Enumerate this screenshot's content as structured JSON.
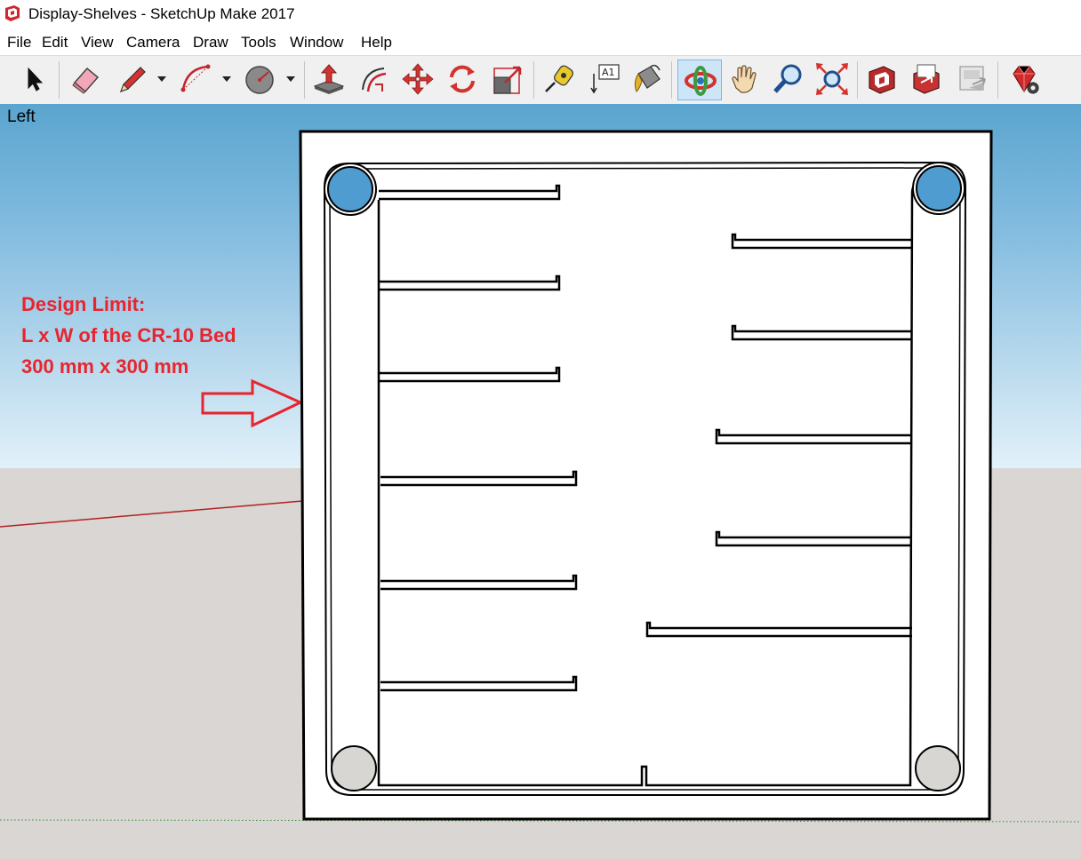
{
  "window": {
    "title": "Display-Shelves - SketchUp Make 2017",
    "app_icon": "sketchup-icon"
  },
  "menu": {
    "items": [
      "File",
      "Edit",
      "View",
      "Camera",
      "Draw",
      "Tools",
      "Window",
      "Help"
    ]
  },
  "toolbar": {
    "tools": [
      {
        "name": "select-tool",
        "icon": "arrow-cursor-icon"
      },
      {
        "name": "eraser-tool",
        "icon": "eraser-icon"
      },
      {
        "name": "line-tool",
        "icon": "pencil-icon"
      },
      {
        "name": "arc-tool",
        "icon": "arc-icon"
      },
      {
        "name": "shape-tool",
        "icon": "circle-icon"
      },
      {
        "name": "push-pull-tool",
        "icon": "push-pull-icon"
      },
      {
        "name": "offset-tool",
        "icon": "offset-icon"
      },
      {
        "name": "move-tool",
        "icon": "move-icon"
      },
      {
        "name": "rotate-tool",
        "icon": "rotate-icon"
      },
      {
        "name": "scale-tool",
        "icon": "scale-icon"
      },
      {
        "name": "tape-measure-tool",
        "icon": "tape-measure-icon"
      },
      {
        "name": "text-tool",
        "icon": "text-label-icon"
      },
      {
        "name": "paint-bucket-tool",
        "icon": "paint-bucket-icon"
      },
      {
        "name": "orbit-tool",
        "icon": "orbit-icon",
        "active": true
      },
      {
        "name": "pan-tool",
        "icon": "hand-icon"
      },
      {
        "name": "zoom-tool",
        "icon": "magnifier-icon"
      },
      {
        "name": "zoom-extents-tool",
        "icon": "zoom-extents-icon"
      },
      {
        "name": "3d-warehouse-tool",
        "icon": "warehouse-icon"
      },
      {
        "name": "share-model-tool",
        "icon": "share-model-icon"
      },
      {
        "name": "share-component-tool",
        "icon": "share-component-icon"
      },
      {
        "name": "extension-warehouse-tool",
        "icon": "ruby-gem-icon"
      }
    ],
    "text_tool_label": "A1"
  },
  "viewport": {
    "view_name": "Left",
    "annotation": {
      "line1": "Design Limit:",
      "line2": "L x W of the CR-10 Bed",
      "line3": "300 mm x 300 mm"
    },
    "colors": {
      "sky_top": "#5aa5cf",
      "ground": "#d9d6d3",
      "annotation": "#e8242e",
      "red_axis": "#b22222",
      "green_axis": "#2e8b2e",
      "hole_blue": "#4f9cd0",
      "hole_gray": "#d8d6d3"
    }
  }
}
